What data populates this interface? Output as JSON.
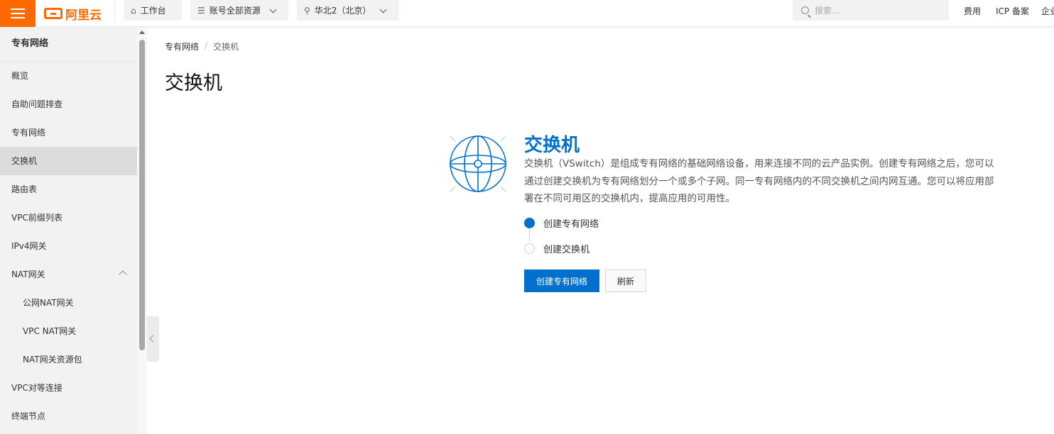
{
  "topbar": {
    "logo_text": "阿里云",
    "workbench_label": "工作台",
    "resources_label": "账号全部资源",
    "region_label": "华北2（北京）",
    "search_placeholder": "搜索...",
    "links": [
      "费用",
      "ICP 备案",
      "企业"
    ]
  },
  "sidebar": {
    "title": "专有网络",
    "items": [
      {
        "label": "概览"
      },
      {
        "label": "自助问题排查"
      },
      {
        "label": "专有网络"
      },
      {
        "label": "交换机",
        "active": true
      },
      {
        "label": "路由表"
      },
      {
        "label": "VPC前缀列表"
      },
      {
        "label": "IPv4网关"
      },
      {
        "label": "NAT网关",
        "expanded": true
      },
      {
        "label": "公网NAT网关",
        "sub": true
      },
      {
        "label": "VPC NAT网关",
        "sub": true
      },
      {
        "label": "NAT网关资源包",
        "sub": true
      },
      {
        "label": "VPC对等连接"
      },
      {
        "label": "终端节点"
      }
    ]
  },
  "breadcrumb": {
    "parent": "专有网络",
    "separator": "/",
    "current": "交换机"
  },
  "page": {
    "title": "交换机"
  },
  "intro": {
    "title": "交换机",
    "description": "交换机（VSwitch）是组成专有网络的基础网络设备，用来连接不同的云产品实例。创建专有网络之后，您可以通过创建交换机为专有网络划分一个或多个子网。同一专有网络内的不同交换机之间内网互通。您可以将应用部署在不同可用区的交换机内，提高应用的可用性。",
    "icon": "globe-network-icon",
    "steps": [
      {
        "label": "创建专有网络",
        "active": true
      },
      {
        "label": "创建交换机",
        "active": false
      }
    ],
    "primary_button": "创建专有网络",
    "secondary_button": "刷新"
  },
  "colors": {
    "brand_orange": "#ff6a00",
    "accent_blue": "#0070cc"
  }
}
